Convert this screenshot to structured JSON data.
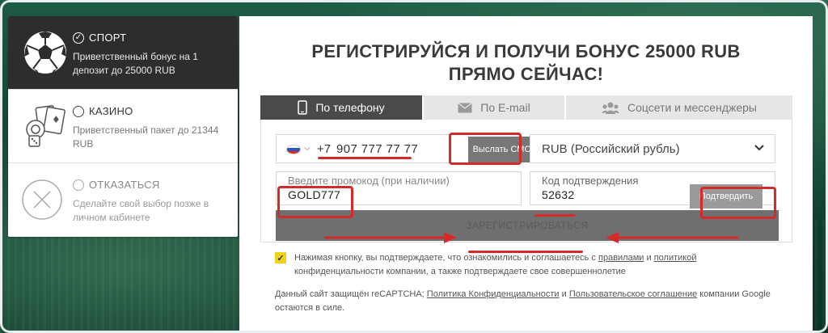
{
  "bonus_options": [
    {
      "title": "СПОРТ",
      "desc": "Приветственный бонус на 1 депозит до 25000 RUB",
      "icon": "soccer-ball-icon",
      "selected": true
    },
    {
      "title": "КАЗИНО",
      "desc": "Приветственный пакет до 21344 RUB",
      "icon": "casino-cards-icon",
      "selected": false
    },
    {
      "title": "ОТКАЗАТЬСЯ",
      "desc": "Сделайте свой выбор позже в личном кабинете",
      "icon": "decline-x-icon",
      "selected": false
    }
  ],
  "headline": {
    "line1": "РЕГИСТРИРУЙСЯ И ПОЛУЧИ БОНУС 25000 RUB",
    "line2": "ПРЯМО СЕЙЧАС!"
  },
  "tabs": [
    {
      "label": "По телефону",
      "icon": "phone-icon",
      "active": true
    },
    {
      "label": "По E-mail",
      "icon": "envelope-icon",
      "active": false
    },
    {
      "label": "Соцсети и мессенджеры",
      "icon": "users-icon",
      "active": false
    }
  ],
  "form": {
    "country_code": "+7",
    "phone": "907 777 77 77",
    "send_sms_label": "Выслать СМС",
    "currency": "RUB (Российский рубль)",
    "promo_placeholder": "Введите промокод (при наличии)",
    "promo_value": "GOLD777",
    "confirm_placeholder": "Код подтверждения",
    "confirm_value": "52632",
    "confirm_button": "Подтвердить",
    "register_button": "ЗАРЕГИСТРИРОВАТЬСЯ"
  },
  "consent": {
    "part1": "Нажимая кнопку, вы подтверждаете, что ознакомились и соглашаетесь с ",
    "link_rules": "правилами",
    "and": " и ",
    "link_policy": "политикой",
    "part2": " конфиденциальности компании, а также подтверждаете свое совершеннолетие"
  },
  "recaptcha": {
    "part1": "Данный сайт защищён reCAPTCHA; ",
    "link_privacy": "Политика Конфиденциальности",
    "and": " и ",
    "link_terms": "Пользовательское соглашение",
    "part2": " компании Google остаются в силе."
  },
  "colors": {
    "highlight": "#d42a2a",
    "active_dark": "#2d2d2d",
    "checkbox": "#f0d21d"
  }
}
